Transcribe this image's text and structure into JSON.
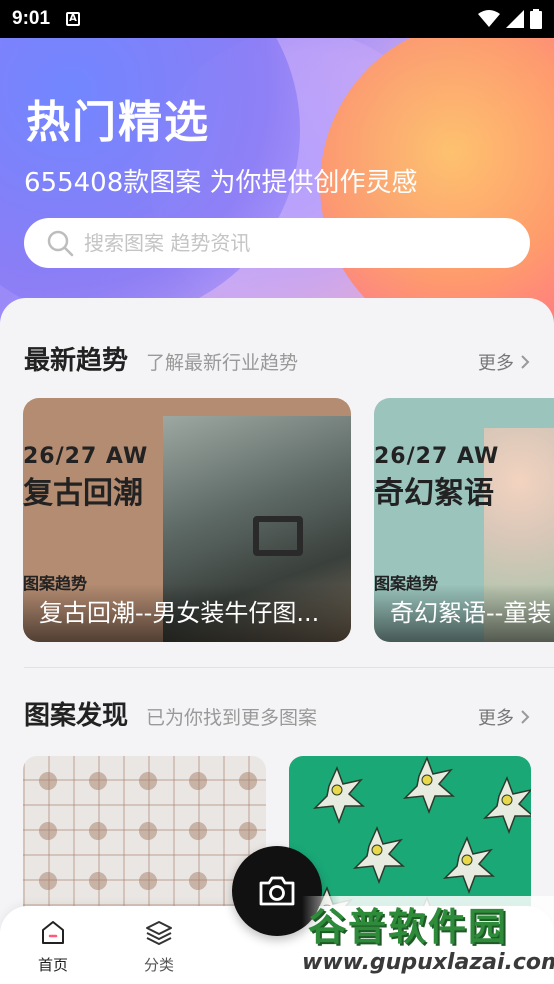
{
  "status_bar": {
    "time": "9:01",
    "notif_icon_letter": "A"
  },
  "hero": {
    "title": "热门精选",
    "subtitle": "655408款图案 为你提供创作灵感",
    "search_placeholder": "搜索图案 趋势资讯"
  },
  "trends_section": {
    "title": "最新趋势",
    "subtitle": "了解最新行业趋势",
    "more_label": "更多",
    "cards": [
      {
        "season": "26/27 AW",
        "name": "复古回潮",
        "tag": "图案趋势",
        "caption": "复古回潮--男女装牛仔图...",
        "bg": "#b48c72"
      },
      {
        "season": "26/27 AW",
        "name": "奇幻絮语",
        "tag": "图案趋势",
        "caption": "奇幻絮语--童装",
        "bg": "#9bc4bd"
      }
    ]
  },
  "patterns_section": {
    "title": "图案发现",
    "subtitle": "已为你找到更多图案",
    "more_label": "更多"
  },
  "bottom_nav": {
    "items": [
      {
        "label": "首页",
        "icon": "home-icon",
        "active": true
      },
      {
        "label": "分类",
        "icon": "layers-icon",
        "active": false
      }
    ]
  },
  "watermark": {
    "title": "谷普软件园",
    "url": "www.gupuxlazai.com"
  },
  "colors": {
    "accent": "#111111",
    "pattern_green": "#1aa877"
  }
}
